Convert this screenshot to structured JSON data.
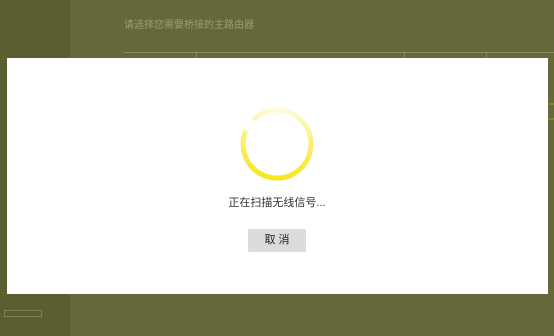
{
  "background": {
    "title": "请选择您需要桥接的主路由器"
  },
  "modal": {
    "spinner": {
      "icon": "loading-spinner-icon",
      "color": "#f5e200"
    },
    "status_text": "正在扫描无线信号...",
    "cancel_label": "取 消"
  }
}
